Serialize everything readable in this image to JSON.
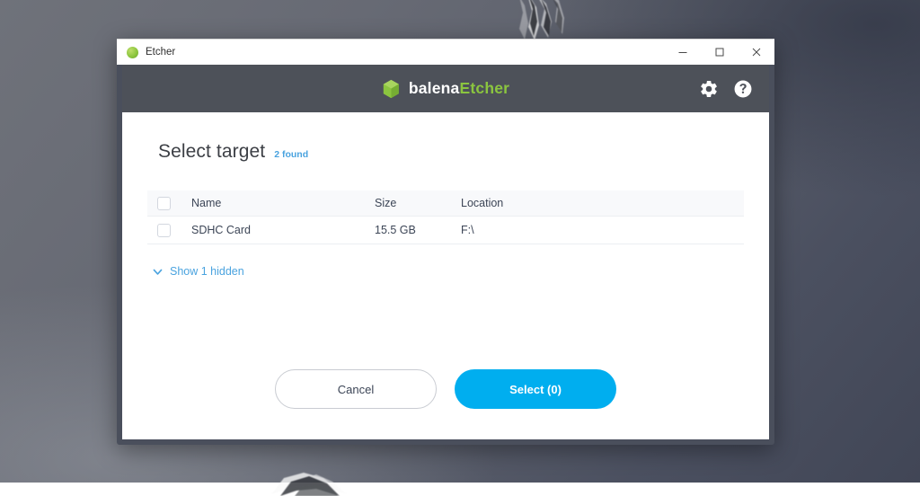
{
  "window": {
    "title": "Etcher",
    "app_icon": "etcher-leaf-icon",
    "controls": [
      {
        "name": "minimize",
        "icon": "minimize-icon"
      },
      {
        "name": "maximize",
        "icon": "maximize-icon"
      },
      {
        "name": "close",
        "icon": "close-icon"
      }
    ]
  },
  "toolbar": {
    "brand_primary": "balena",
    "brand_secondary": "Etcher",
    "logo_icon": "balena-cube-icon",
    "settings_icon": "gear-icon",
    "help_icon": "help-circle-icon"
  },
  "main": {
    "title": "Select target",
    "found_badge": "2 found",
    "table": {
      "columns": [
        "Name",
        "Size",
        "Location"
      ],
      "header_checkbox_checked": false,
      "rows": [
        {
          "checked": false,
          "name": "SDHC Card",
          "size": "15.5 GB",
          "location": "F:\\"
        }
      ]
    },
    "show_hidden": {
      "label": "Show 1 hidden",
      "icon": "chevron-down-icon"
    }
  },
  "footer": {
    "cancel_label": "Cancel",
    "select_label": "Select (0)"
  },
  "colors": {
    "accent_blue": "#00aeef",
    "link_blue": "#4aa3df",
    "brand_green": "#8bc53f",
    "toolbar_dark": "#4d5159",
    "frame_dark": "#4a4f5c",
    "text_dark": "#3c4556",
    "table_header_bg": "#f8f9fb"
  }
}
